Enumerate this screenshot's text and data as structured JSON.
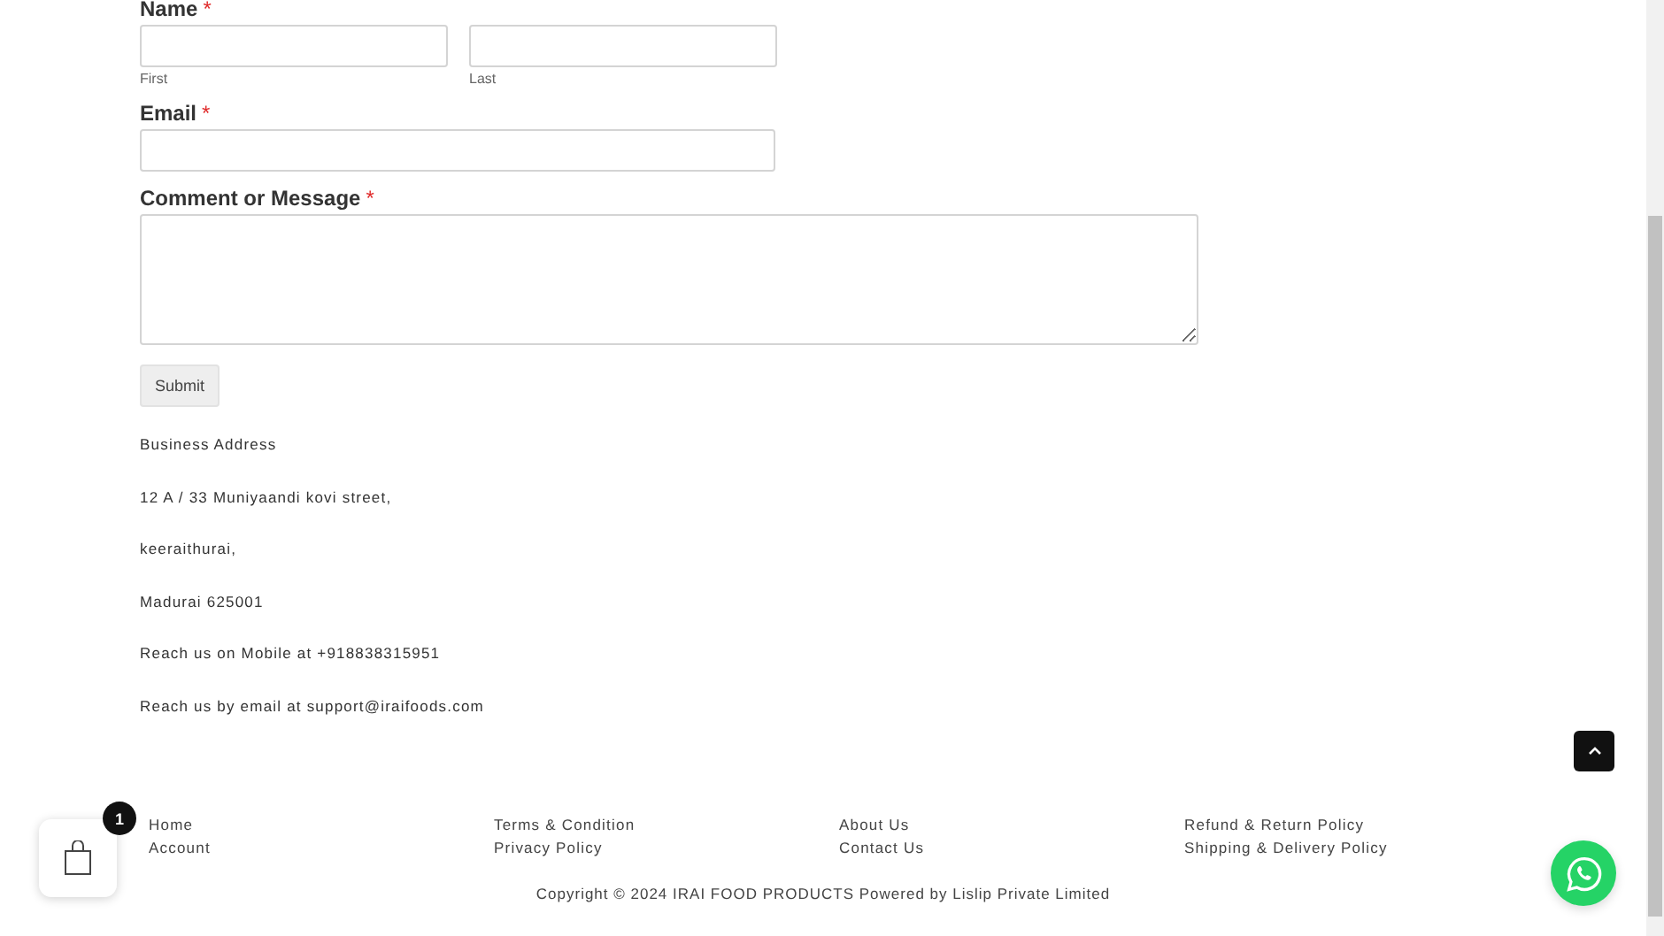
{
  "form": {
    "name_label": "Name",
    "required_mark": "*",
    "first_sublabel": "First",
    "last_sublabel": "Last",
    "email_label": "Email",
    "message_label": "Comment or Message",
    "submit": "Submit"
  },
  "address_lines": [
    "Business Address",
    "12 A / 33 Muniyaandi kovi street,",
    "keeraithurai,",
    "Madurai 625001",
    "Reach us on Mobile at +918838315951",
    "Reach us by email at support@iraifoods.com"
  ],
  "footer_columns": [
    [
      "Home",
      "Account"
    ],
    [
      "Terms & Condition",
      "Privacy Policy"
    ],
    [
      "About Us",
      "Contact Us"
    ],
    [
      "Refund & Return Policy",
      "Shipping & Delivery Policy"
    ]
  ],
  "copyright": "Copyright © 2024 IRAI FOOD PRODUCTS Powered by Lislip Private Limited",
  "cart": {
    "count": "1"
  }
}
